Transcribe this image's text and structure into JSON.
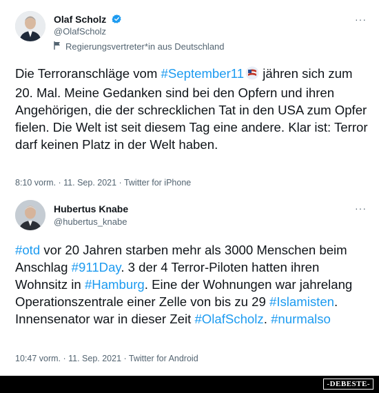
{
  "tweet1": {
    "name": "Olaf Scholz",
    "handle": "@OlafScholz",
    "label": "Regierungsvertreter*in aus Deutschland",
    "body": [
      {
        "t": "Die Terroranschläge vom ",
        "h": false
      },
      {
        "t": "#September11",
        "h": true
      },
      {
        "t": " jähren sich zum 20. Mal. Meine Gedanken sind bei den Opfern und ihren Angehörigen, die der schrecklichen Tat in den USA zum Opfer fielen. Die Welt ist seit diesem Tag eine andere. Klar ist: Terror darf keinen Platz in der Welt haben.",
        "h": false
      }
    ],
    "meta": "8:10 vorm. · 11. Sep. 2021 · Twitter for iPhone",
    "more": "···"
  },
  "tweet2": {
    "name": "Hubertus Knabe",
    "handle": "@hubertus_knabe",
    "body": [
      {
        "t": "#otd",
        "h": true
      },
      {
        "t": " vor 20 Jahren starben mehr als 3000 Menschen beim Anschlag ",
        "h": false
      },
      {
        "t": "#911Day",
        "h": true
      },
      {
        "t": ". 3 der 4 Terror-Piloten hatten ihren Wohnsitz in ",
        "h": false
      },
      {
        "t": "#Hamburg",
        "h": true
      },
      {
        "t": ". Eine der  Wohnungen war jahrelang Operationszentrale einer Zelle von bis zu 29 ",
        "h": false
      },
      {
        "t": "#Islamisten",
        "h": true
      },
      {
        "t": ". Innensenator war in dieser Zeit ",
        "h": false
      },
      {
        "t": "#OlafScholz",
        "h": true
      },
      {
        "t": ". ",
        "h": false
      },
      {
        "t": "#nurmalso",
        "h": true
      }
    ],
    "meta": "10:47 vorm. · 11. Sep. 2021 · Twitter for Android",
    "more": "···"
  },
  "watermark": "-DEBESTE-",
  "colors": {
    "link": "#1d9bf0",
    "verified": "#1d9bf0",
    "muted": "#536471"
  }
}
